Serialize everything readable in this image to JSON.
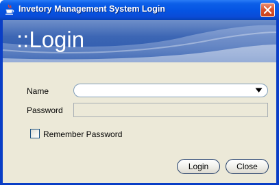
{
  "window": {
    "title": "Invetory Management System Login",
    "icon": "java-cup-icon",
    "close_icon": "close-icon"
  },
  "banner": {
    "title": "::Login"
  },
  "form": {
    "name_label": "Name",
    "name_value": "",
    "password_label": "Password",
    "password_value": "",
    "remember_label": "Remember Password",
    "remember_checked": false
  },
  "buttons": {
    "login": "Login",
    "close": "Close"
  },
  "colors": {
    "titlebar": "#0553e2",
    "banner": "#3c66b4",
    "client_background": "#ece9d8",
    "close_button": "#d94f2a"
  }
}
